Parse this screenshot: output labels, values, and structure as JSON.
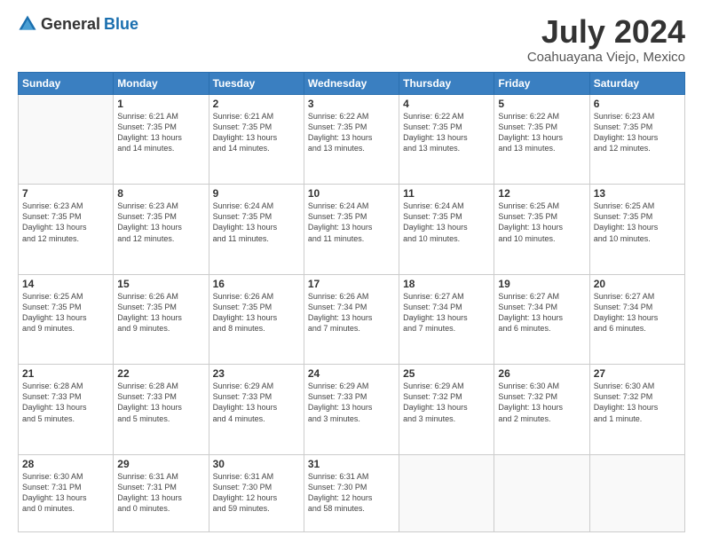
{
  "logo": {
    "general": "General",
    "blue": "Blue"
  },
  "title": "July 2024",
  "location": "Coahuayana Viejo, Mexico",
  "days_of_week": [
    "Sunday",
    "Monday",
    "Tuesday",
    "Wednesday",
    "Thursday",
    "Friday",
    "Saturday"
  ],
  "weeks": [
    [
      {
        "day": "",
        "info": ""
      },
      {
        "day": "1",
        "info": "Sunrise: 6:21 AM\nSunset: 7:35 PM\nDaylight: 13 hours\nand 14 minutes."
      },
      {
        "day": "2",
        "info": "Sunrise: 6:21 AM\nSunset: 7:35 PM\nDaylight: 13 hours\nand 14 minutes."
      },
      {
        "day": "3",
        "info": "Sunrise: 6:22 AM\nSunset: 7:35 PM\nDaylight: 13 hours\nand 13 minutes."
      },
      {
        "day": "4",
        "info": "Sunrise: 6:22 AM\nSunset: 7:35 PM\nDaylight: 13 hours\nand 13 minutes."
      },
      {
        "day": "5",
        "info": "Sunrise: 6:22 AM\nSunset: 7:35 PM\nDaylight: 13 hours\nand 13 minutes."
      },
      {
        "day": "6",
        "info": "Sunrise: 6:23 AM\nSunset: 7:35 PM\nDaylight: 13 hours\nand 12 minutes."
      }
    ],
    [
      {
        "day": "7",
        "info": "Sunrise: 6:23 AM\nSunset: 7:35 PM\nDaylight: 13 hours\nand 12 minutes."
      },
      {
        "day": "8",
        "info": "Sunrise: 6:23 AM\nSunset: 7:35 PM\nDaylight: 13 hours\nand 12 minutes."
      },
      {
        "day": "9",
        "info": "Sunrise: 6:24 AM\nSunset: 7:35 PM\nDaylight: 13 hours\nand 11 minutes."
      },
      {
        "day": "10",
        "info": "Sunrise: 6:24 AM\nSunset: 7:35 PM\nDaylight: 13 hours\nand 11 minutes."
      },
      {
        "day": "11",
        "info": "Sunrise: 6:24 AM\nSunset: 7:35 PM\nDaylight: 13 hours\nand 10 minutes."
      },
      {
        "day": "12",
        "info": "Sunrise: 6:25 AM\nSunset: 7:35 PM\nDaylight: 13 hours\nand 10 minutes."
      },
      {
        "day": "13",
        "info": "Sunrise: 6:25 AM\nSunset: 7:35 PM\nDaylight: 13 hours\nand 10 minutes."
      }
    ],
    [
      {
        "day": "14",
        "info": "Sunrise: 6:25 AM\nSunset: 7:35 PM\nDaylight: 13 hours\nand 9 minutes."
      },
      {
        "day": "15",
        "info": "Sunrise: 6:26 AM\nSunset: 7:35 PM\nDaylight: 13 hours\nand 9 minutes."
      },
      {
        "day": "16",
        "info": "Sunrise: 6:26 AM\nSunset: 7:35 PM\nDaylight: 13 hours\nand 8 minutes."
      },
      {
        "day": "17",
        "info": "Sunrise: 6:26 AM\nSunset: 7:34 PM\nDaylight: 13 hours\nand 7 minutes."
      },
      {
        "day": "18",
        "info": "Sunrise: 6:27 AM\nSunset: 7:34 PM\nDaylight: 13 hours\nand 7 minutes."
      },
      {
        "day": "19",
        "info": "Sunrise: 6:27 AM\nSunset: 7:34 PM\nDaylight: 13 hours\nand 6 minutes."
      },
      {
        "day": "20",
        "info": "Sunrise: 6:27 AM\nSunset: 7:34 PM\nDaylight: 13 hours\nand 6 minutes."
      }
    ],
    [
      {
        "day": "21",
        "info": "Sunrise: 6:28 AM\nSunset: 7:33 PM\nDaylight: 13 hours\nand 5 minutes."
      },
      {
        "day": "22",
        "info": "Sunrise: 6:28 AM\nSunset: 7:33 PM\nDaylight: 13 hours\nand 5 minutes."
      },
      {
        "day": "23",
        "info": "Sunrise: 6:29 AM\nSunset: 7:33 PM\nDaylight: 13 hours\nand 4 minutes."
      },
      {
        "day": "24",
        "info": "Sunrise: 6:29 AM\nSunset: 7:33 PM\nDaylight: 13 hours\nand 3 minutes."
      },
      {
        "day": "25",
        "info": "Sunrise: 6:29 AM\nSunset: 7:32 PM\nDaylight: 13 hours\nand 3 minutes."
      },
      {
        "day": "26",
        "info": "Sunrise: 6:30 AM\nSunset: 7:32 PM\nDaylight: 13 hours\nand 2 minutes."
      },
      {
        "day": "27",
        "info": "Sunrise: 6:30 AM\nSunset: 7:32 PM\nDaylight: 13 hours\nand 1 minute."
      }
    ],
    [
      {
        "day": "28",
        "info": "Sunrise: 6:30 AM\nSunset: 7:31 PM\nDaylight: 13 hours\nand 0 minutes."
      },
      {
        "day": "29",
        "info": "Sunrise: 6:31 AM\nSunset: 7:31 PM\nDaylight: 13 hours\nand 0 minutes."
      },
      {
        "day": "30",
        "info": "Sunrise: 6:31 AM\nSunset: 7:30 PM\nDaylight: 12 hours\nand 59 minutes."
      },
      {
        "day": "31",
        "info": "Sunrise: 6:31 AM\nSunset: 7:30 PM\nDaylight: 12 hours\nand 58 minutes."
      },
      {
        "day": "",
        "info": ""
      },
      {
        "day": "",
        "info": ""
      },
      {
        "day": "",
        "info": ""
      }
    ]
  ]
}
